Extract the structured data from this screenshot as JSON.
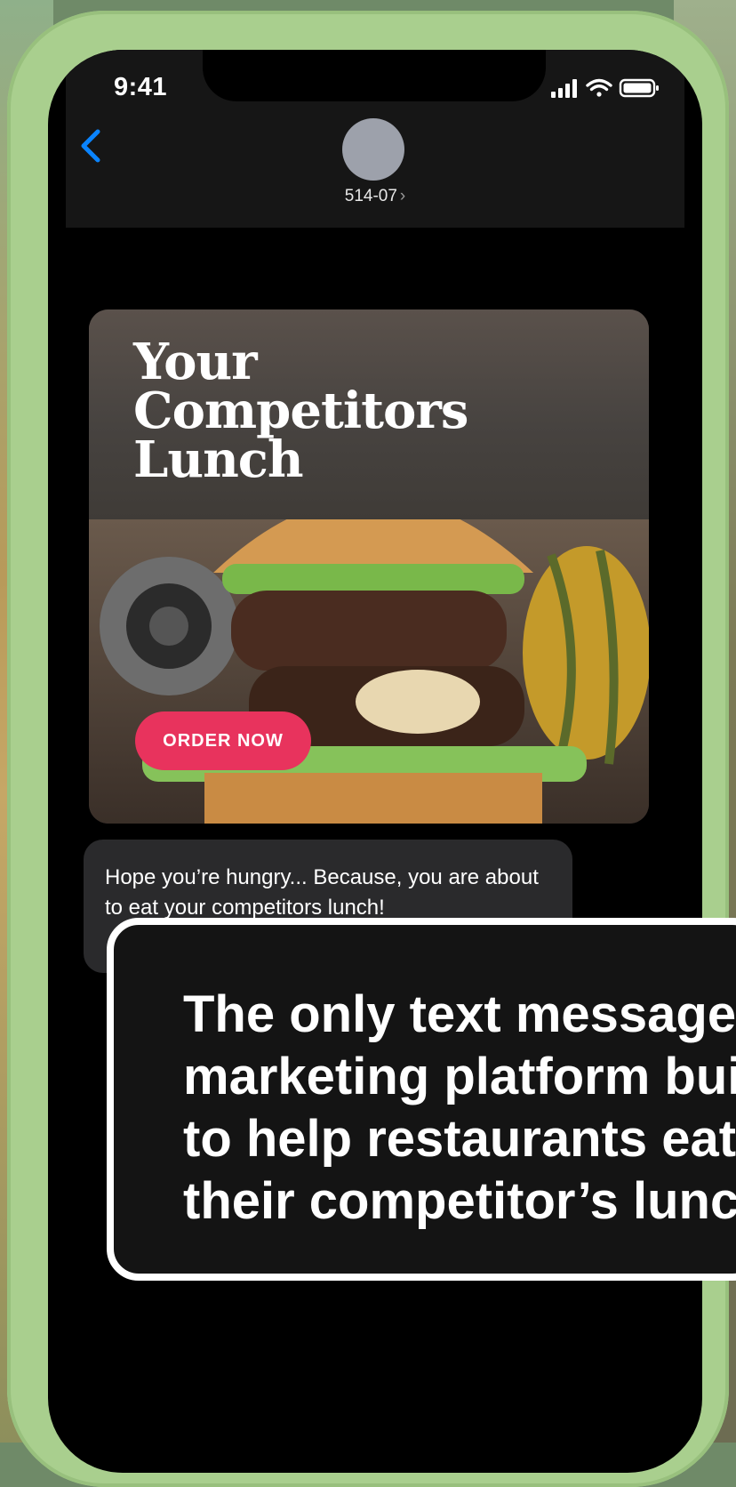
{
  "status_bar": {
    "time": "9:41"
  },
  "conversation": {
    "contact_name": "514-07",
    "contact_chevron": "›"
  },
  "mms_image": {
    "headline": [
      "Your",
      "Competitors",
      "Lunch"
    ],
    "cta_label": "ORDER NOW"
  },
  "message": {
    "text": "Hope you’re hungry... Because, you are about to eat your competitors lunch!"
  },
  "caption": {
    "lines": [
      "The only text message",
      "marketing platform built",
      "to help restaurants eat",
      "their competitor’s lunch"
    ]
  },
  "colors": {
    "accent_blue": "#0a84ff",
    "cta_pink": "#e8335d",
    "case_green": "#a9cf8e",
    "bubble_gray": "#2a2a2c"
  }
}
